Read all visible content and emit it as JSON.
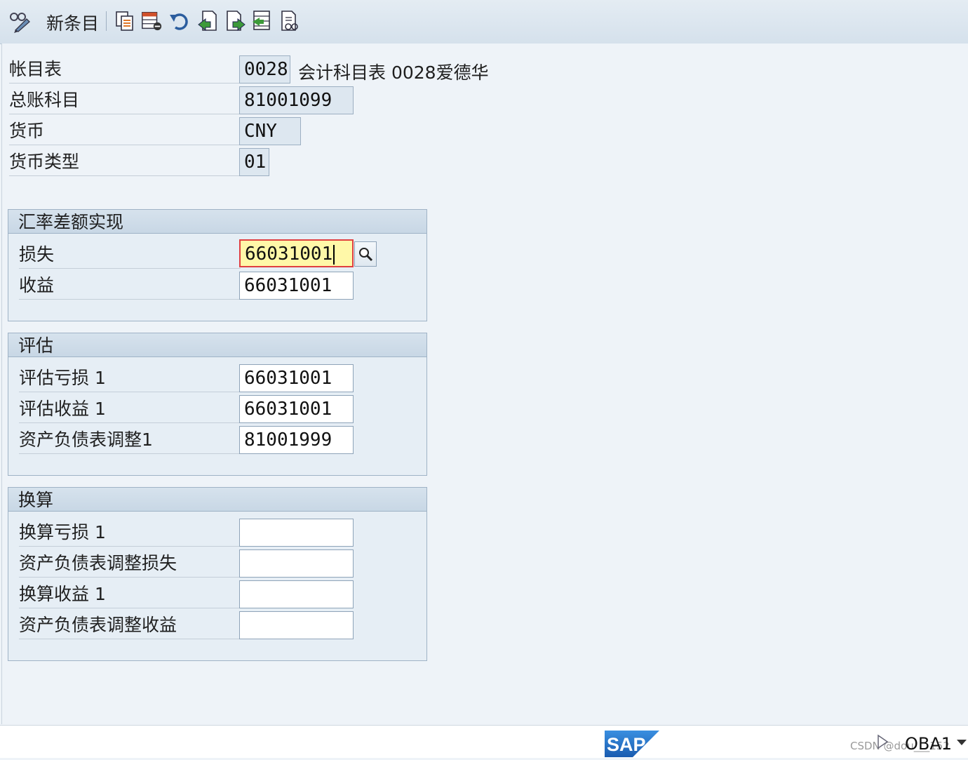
{
  "toolbar": {
    "new_entries_label": "新条目",
    "icons": [
      "display-change-icon",
      "copy-icon",
      "delete-icon",
      "undo-icon",
      "previous-entry-icon",
      "next-entry-icon",
      "select-all-icon",
      "details-icon"
    ]
  },
  "header": {
    "chart_of_accounts": {
      "label": "帐目表",
      "value": "0028",
      "description": "会计科目表 0028爱德华"
    },
    "gl_account": {
      "label": "总账科目",
      "value": "81001099"
    },
    "currency": {
      "label": "货币",
      "value": "CNY"
    },
    "currency_type": {
      "label": "货币类型",
      "value": "01"
    }
  },
  "groups": {
    "realized": {
      "title": "汇率差额实现",
      "loss": {
        "label": "损失",
        "value": "66031001"
      },
      "gain": {
        "label": "收益",
        "value": "66031001"
      }
    },
    "valuation": {
      "title": "评估",
      "val_loss": {
        "label": "评估亏损 1",
        "value": "66031001"
      },
      "val_gain": {
        "label": "评估收益 1",
        "value": "66031001"
      },
      "bs_adjust": {
        "label": "资产负债表调整1",
        "value": "81001999"
      }
    },
    "translation": {
      "title": "换算",
      "trans_loss": {
        "label": "换算亏损 1",
        "value": ""
      },
      "bs_adjust_loss": {
        "label": "资产负债表调整损失",
        "value": ""
      },
      "trans_gain": {
        "label": "换算收益 1",
        "value": ""
      },
      "bs_adjust_gain": {
        "label": "资产负债表调整收益",
        "value": ""
      }
    }
  },
  "statusbar": {
    "logo_text": "SAP",
    "transaction": "OBA1",
    "watermark": "CSDN @dou___152"
  },
  "colors": {
    "background": "#eef3f8",
    "focus_fill": "#fff8a8",
    "focus_border": "#e04040",
    "sap_blue": "#1f6fc4"
  }
}
